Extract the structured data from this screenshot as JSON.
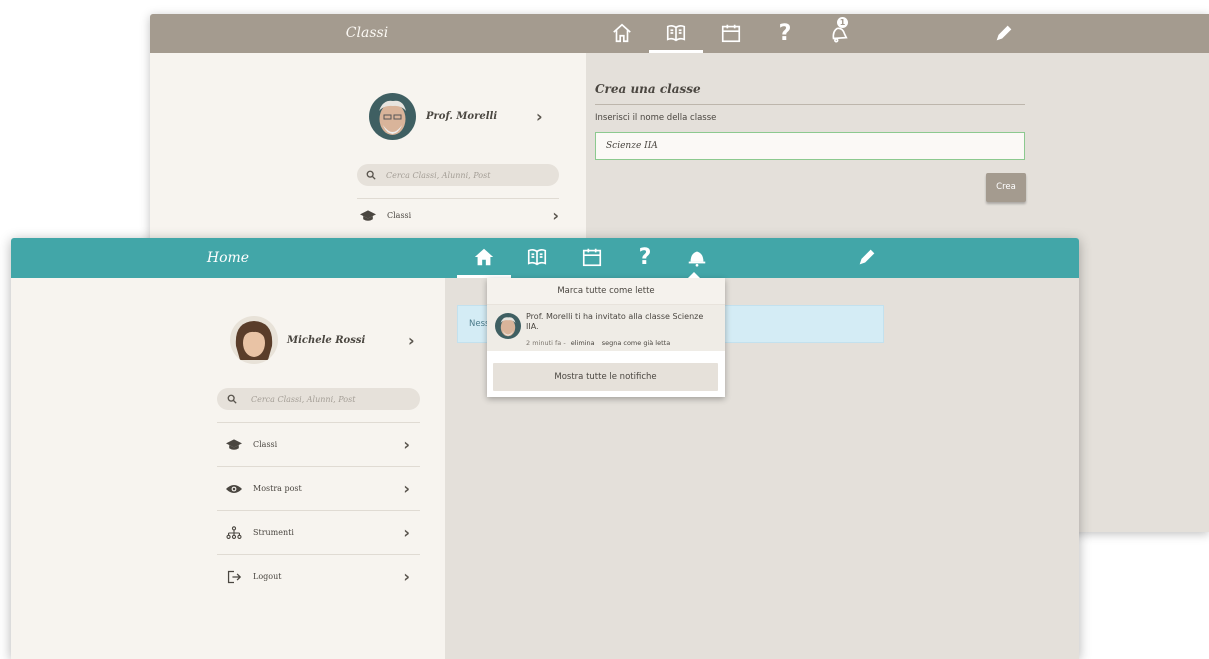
{
  "back_window": {
    "title": "Classi",
    "notification_count": "1",
    "profile_name": "Prof. Morelli",
    "search_placeholder": "Cerca Classi, Alunni, Post",
    "menu_classi": "Classi",
    "form": {
      "title": "Crea una classe",
      "label": "Inserisci il nome della classe",
      "value": "Scienze IIA",
      "button": "Crea"
    }
  },
  "front_window": {
    "title": "Home",
    "profile_name": "Michele Rossi",
    "search_placeholder": "Cerca Classi, Alunni, Post",
    "menu": [
      {
        "label": "Classi",
        "icon": "graduation-cap-icon"
      },
      {
        "label": "Mostra post",
        "icon": "eye-icon"
      },
      {
        "label": "Strumenti",
        "icon": "hierarchy-icon"
      },
      {
        "label": "Logout",
        "icon": "logout-icon"
      }
    ],
    "banner_text": "Ness",
    "notifications": {
      "mark_all": "Marca tutte come lette",
      "item": {
        "message": "Prof. Morelli ti ha invitato alla classe Scienze IIA.",
        "time": "2 minuti fa -",
        "delete": "elimina",
        "mark_read": "segna come già letta"
      },
      "show_all": "Mostra tutte le notifiche"
    }
  },
  "colors": {
    "back_topbar": "#a49b8f",
    "front_topbar": "#42a6a8",
    "sidebar_bg": "#f7f4ef",
    "content_bg": "#e4e0da"
  }
}
